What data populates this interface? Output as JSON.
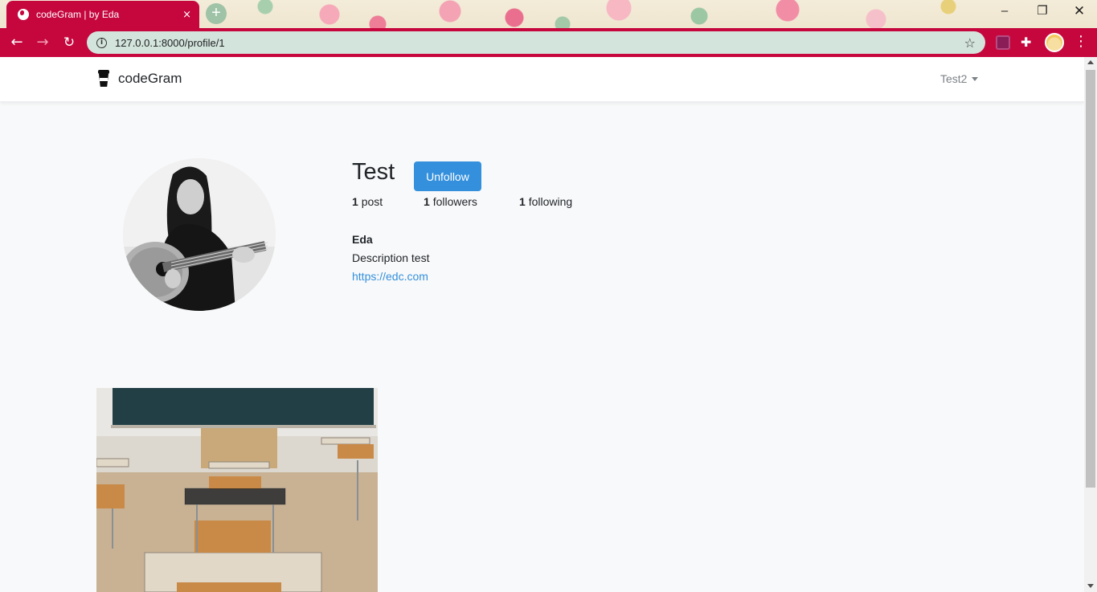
{
  "browser": {
    "tab_title": "codeGram | by Eda",
    "tab_close": "×",
    "new_tab": "+",
    "url": "127.0.0.1:8000/profile/1",
    "window_min": "–",
    "window_max": "❐",
    "window_close": "✕",
    "icons": [
      "globe-icon",
      "info-icon",
      "star-icon",
      "puzzle-icon",
      "menu-icon"
    ]
  },
  "app": {
    "brand": "codeGram",
    "user_menu_label": "Test2"
  },
  "profile": {
    "username": "Test",
    "follow_button_label": "Unfollow",
    "stats": {
      "posts_count": "1",
      "posts_label": "post",
      "followers_count": "1",
      "followers_label": "followers",
      "following_count": "1",
      "following_label": "following"
    },
    "display_name": "Eda",
    "description": "Description test",
    "url": "https://edc.com"
  },
  "colors": {
    "browser_accent": "#c5073e",
    "omnibox_bg": "#d3e4dc",
    "primary_button": "#3490dc",
    "link": "#3490dc",
    "page_bg": "#f8f9fa"
  }
}
